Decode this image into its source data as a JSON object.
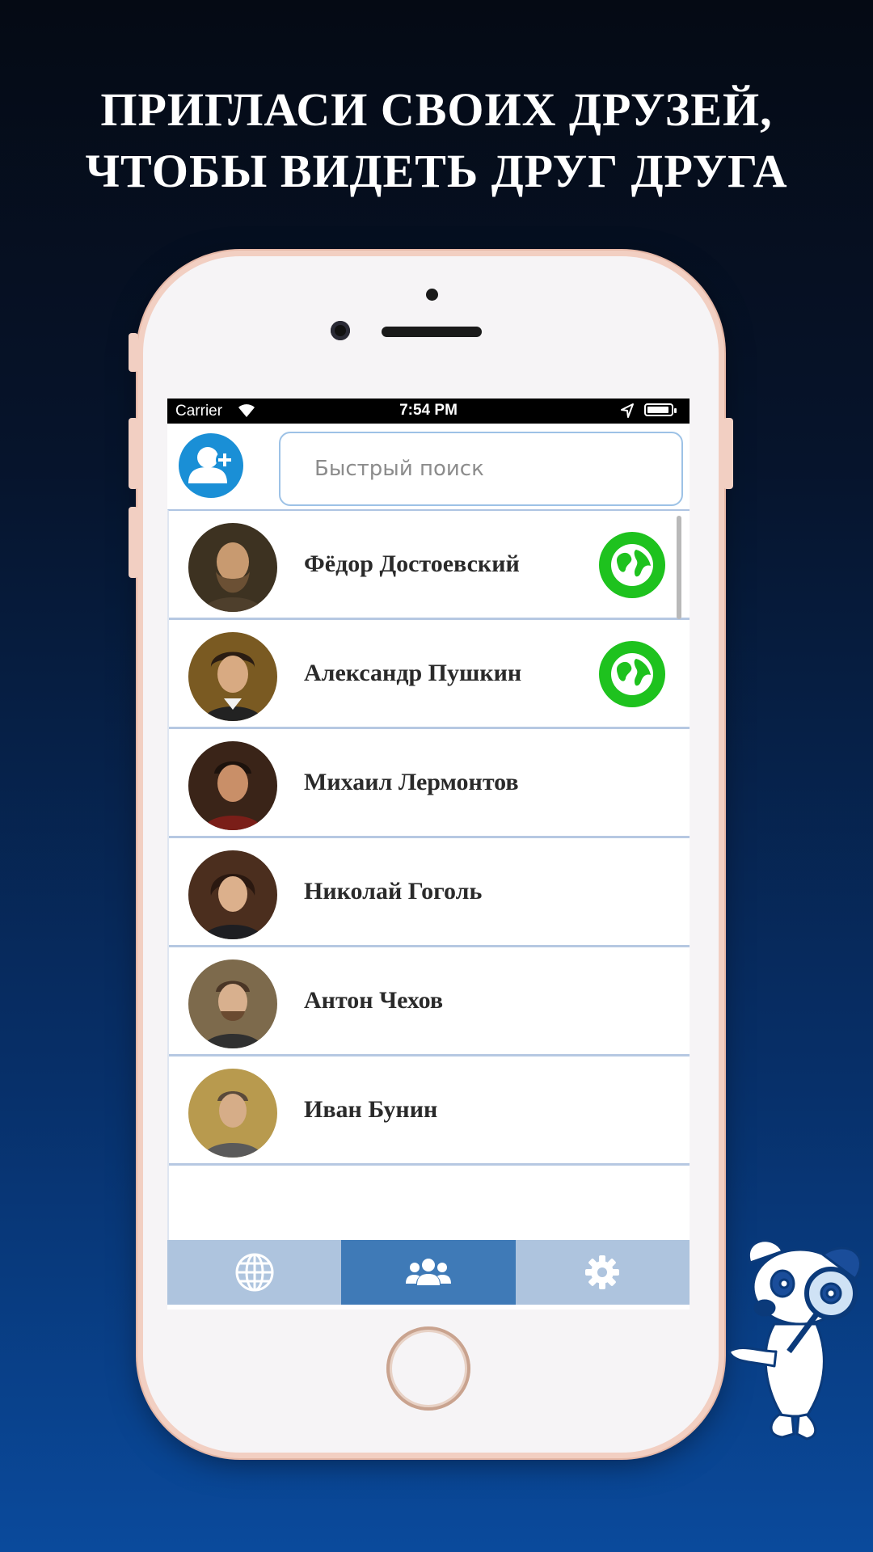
{
  "headline": {
    "line1": "ПРИГЛАСИ СВОИХ ДРУЗЕЙ,",
    "line2": "ЧТОБЫ ВИДЕТЬ ДРУГ ДРУГА"
  },
  "status_bar": {
    "carrier": "Carrier",
    "time": "7:54 PM"
  },
  "search": {
    "placeholder": "Быстрый поиск"
  },
  "friends": [
    {
      "name": "Фёдор Достоевский",
      "online": true
    },
    {
      "name": "Александр Пушкин",
      "online": true
    },
    {
      "name": "Михаил Лермонтов",
      "online": false
    },
    {
      "name": "Николай Гоголь",
      "online": false
    },
    {
      "name": "Антон Чехов",
      "online": false
    },
    {
      "name": "Иван Бунин",
      "online": false
    }
  ],
  "tabs": [
    {
      "icon": "globe-icon",
      "active": false
    },
    {
      "icon": "friends-icon",
      "active": true
    },
    {
      "icon": "gear-icon",
      "active": false
    }
  ],
  "colors": {
    "add_button": "#1a8fd6",
    "online_badge": "#1ec21e",
    "tab_active": "#3f7ab7",
    "tab_inactive": "#aec4de"
  }
}
